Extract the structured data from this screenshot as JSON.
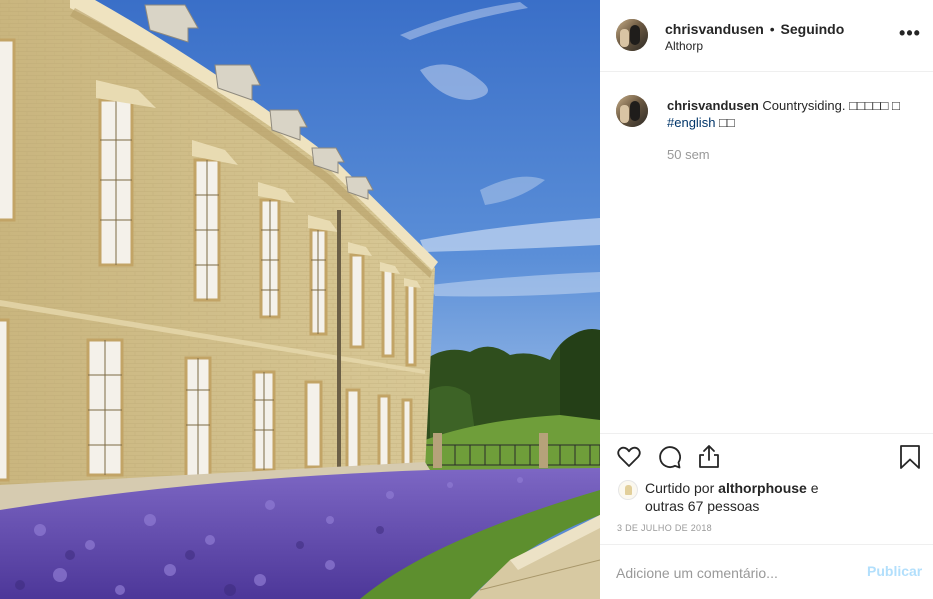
{
  "post": {
    "username": "chrisvandusen",
    "separator": "•",
    "follow_status": "Seguindo",
    "location": "Althorp",
    "more_label": "•••"
  },
  "caption": {
    "username": "chrisvandusen",
    "text": " Countrysiding. □□□□□ □ ",
    "hashtag": "#english",
    "trailing": " □□",
    "time_ago": "50 sem"
  },
  "likes": {
    "prefix": "Curtido por ",
    "liker": "althorphouse",
    "suffix": " e outras 67 pessoas"
  },
  "date": "3 DE JULHO DE 2018",
  "comment_box": {
    "placeholder": "Adicione um comentário...",
    "publish_label": "Publicar"
  },
  "icons": {
    "like": "heart-outline-icon",
    "comment": "speech-bubble-icon",
    "share": "share-icon",
    "save": "bookmark-icon"
  },
  "colors": {
    "sky": "#4a7fd0",
    "lavender": "#6a4fb5",
    "brick": "#cdbb84",
    "hashtag": "#003569",
    "publish": "#b2dffc"
  }
}
